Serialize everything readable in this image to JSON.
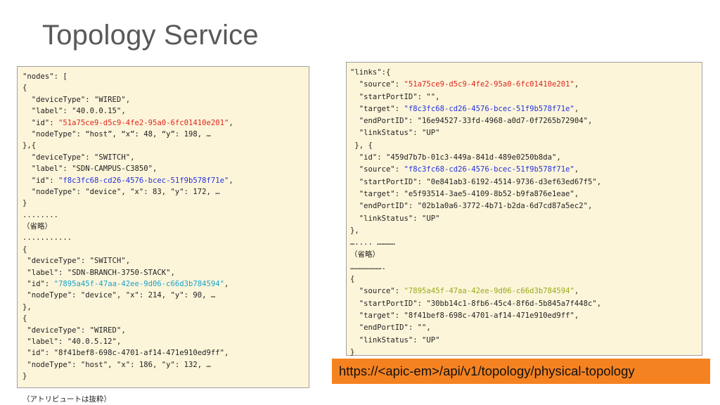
{
  "title": "Topology Service",
  "nodes_panel": {
    "lines": [
      "\"nodes\": [",
      "{",
      "  \"deviceType\": \"WIRED\",",
      "  \"label\": \"40.0.0.15\",",
      "  \"id\": ",
      "  \"nodeType\": “host”, “x”: 48, “y”: 198, …",
      "},{",
      "  \"deviceType\": \"SWITCH\",",
      "  \"label\": \"SDN-CAMPUS-C3850\",",
      "  \"id\": ",
      "  \"nodeType\": \"device\", \"x\": 83, \"y\": 172, …",
      "}",
      "........",
      "（省略）",
      "...........",
      "{",
      " \"deviceType\": \"SWITCH\",",
      " \"label\": \"SDN-BRANCH-3750-STACK\",",
      " \"id\": ",
      " \"nodeType\": \"device\", \"x\": 214, \"y\": 90, …",
      "},",
      "{",
      " \"deviceType\": \"WIRED\",",
      " \"label\": \"40.0.5.12\",",
      " \"id\": \"8f41bef8-698c-4701-af14-471e910ed9ff\",",
      " \"nodeType\": \"host\", \"x\": 186, \"y\": 132, …",
      "}",
      "",
      "（アトリビュートは抜粋）"
    ],
    "highlight_ids": {
      "node1": "\"51a75ce9-d5c9-4fe2-95a0-6fc01410e201\"",
      "node2": "\"f8c3fc68-cd26-4576-bcec-51f9b578f71e\"",
      "node3": "\"7895a45f-47aa-42ee-9d06-c66d3b784594\""
    },
    "trailing_comma": ","
  },
  "links_panel": {
    "lines": [
      "\"links\":{",
      "  \"source\": ",
      "  \"startPortID\": \"\",",
      "  \"target\": ",
      "  \"endPortID\": \"16e94527-33fd-4968-a0d7-0f7265b72904\",",
      "  \"linkStatus\": \"UP\"",
      " }, {",
      "  \"id\": \"459d7b7b-01c3-449a-841d-489e0250b8da\",",
      "  \"source\": ",
      "  \"startPortID\": \"0e841ab3-6192-4514-9736-d3ef63ed67f5\",",
      "  \"target\": \"e5f93514-3ae5-4109-8b52-b9fa876e1eae\",",
      "  \"endPortID\": \"02b1a0a6-3772-4b71-b2da-6d7cd87a5ec2\",",
      "  \"linkStatus\": \"UP\"",
      "},",
      "….... …………",
      "（省略）",
      "………………….",
      "{",
      "  \"source\": ",
      "  \"startPortID\": \"30bb14c1-8fb6-45c4-8f6d-5b845a7f448c\",",
      "  \"target\": \"8f41bef8-698c-4701-af14-471e910ed9ff\",",
      "  \"endPortID\": \"\",",
      "  \"linkStatus\": \"UP\"",
      "}"
    ],
    "highlight_ids": {
      "source1": "\"51a75ce9-d5c9-4fe2-95a0-6fc01410e201\"",
      "target1": "\"f8c3fc68-cd26-4576-bcec-51f9b578f71e\"",
      "source2": "\"f8c3fc68-cd26-4576-bcec-51f9b578f71e\"",
      "source3": "\"7895a45f-47aa-42ee-9d06-c66d3b784594\""
    },
    "trailing_comma": ","
  },
  "url": "https://<apic-em>/api/v1/topology/physical-topology",
  "colors": {
    "panel_bg": "#fdf5da",
    "url_bg": "#f58220",
    "id_red": "#e0251a",
    "id_blue": "#2233dd",
    "id_teal": "#1aa3c8",
    "id_green": "#9aaa1a"
  }
}
